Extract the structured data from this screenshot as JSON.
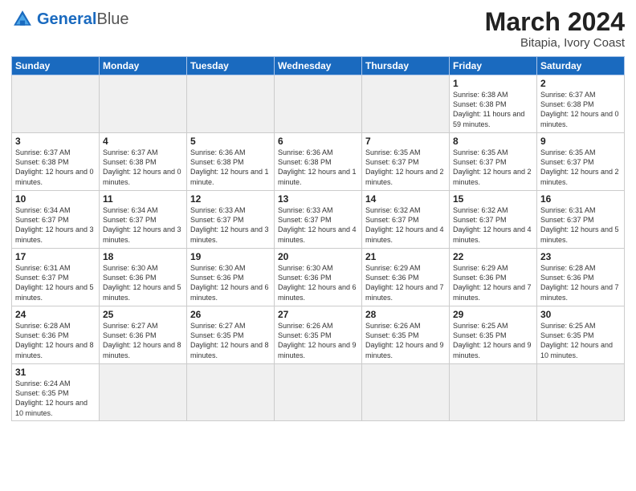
{
  "header": {
    "logo_general": "General",
    "logo_blue": "Blue",
    "month_year": "March 2024",
    "location": "Bitapia, Ivory Coast"
  },
  "days_of_week": [
    "Sunday",
    "Monday",
    "Tuesday",
    "Wednesday",
    "Thursday",
    "Friday",
    "Saturday"
  ],
  "weeks": [
    [
      {
        "day": "",
        "info": ""
      },
      {
        "day": "",
        "info": ""
      },
      {
        "day": "",
        "info": ""
      },
      {
        "day": "",
        "info": ""
      },
      {
        "day": "",
        "info": ""
      },
      {
        "day": "1",
        "info": "Sunrise: 6:38 AM\nSunset: 6:38 PM\nDaylight: 11 hours\nand 59 minutes."
      },
      {
        "day": "2",
        "info": "Sunrise: 6:37 AM\nSunset: 6:38 PM\nDaylight: 12 hours\nand 0 minutes."
      }
    ],
    [
      {
        "day": "3",
        "info": "Sunrise: 6:37 AM\nSunset: 6:38 PM\nDaylight: 12 hours\nand 0 minutes."
      },
      {
        "day": "4",
        "info": "Sunrise: 6:37 AM\nSunset: 6:38 PM\nDaylight: 12 hours\nand 0 minutes."
      },
      {
        "day": "5",
        "info": "Sunrise: 6:36 AM\nSunset: 6:38 PM\nDaylight: 12 hours\nand 1 minute."
      },
      {
        "day": "6",
        "info": "Sunrise: 6:36 AM\nSunset: 6:38 PM\nDaylight: 12 hours\nand 1 minute."
      },
      {
        "day": "7",
        "info": "Sunrise: 6:35 AM\nSunset: 6:37 PM\nDaylight: 12 hours\nand 2 minutes."
      },
      {
        "day": "8",
        "info": "Sunrise: 6:35 AM\nSunset: 6:37 PM\nDaylight: 12 hours\nand 2 minutes."
      },
      {
        "day": "9",
        "info": "Sunrise: 6:35 AM\nSunset: 6:37 PM\nDaylight: 12 hours\nand 2 minutes."
      }
    ],
    [
      {
        "day": "10",
        "info": "Sunrise: 6:34 AM\nSunset: 6:37 PM\nDaylight: 12 hours\nand 3 minutes."
      },
      {
        "day": "11",
        "info": "Sunrise: 6:34 AM\nSunset: 6:37 PM\nDaylight: 12 hours\nand 3 minutes."
      },
      {
        "day": "12",
        "info": "Sunrise: 6:33 AM\nSunset: 6:37 PM\nDaylight: 12 hours\nand 3 minutes."
      },
      {
        "day": "13",
        "info": "Sunrise: 6:33 AM\nSunset: 6:37 PM\nDaylight: 12 hours\nand 4 minutes."
      },
      {
        "day": "14",
        "info": "Sunrise: 6:32 AM\nSunset: 6:37 PM\nDaylight: 12 hours\nand 4 minutes."
      },
      {
        "day": "15",
        "info": "Sunrise: 6:32 AM\nSunset: 6:37 PM\nDaylight: 12 hours\nand 4 minutes."
      },
      {
        "day": "16",
        "info": "Sunrise: 6:31 AM\nSunset: 6:37 PM\nDaylight: 12 hours\nand 5 minutes."
      }
    ],
    [
      {
        "day": "17",
        "info": "Sunrise: 6:31 AM\nSunset: 6:37 PM\nDaylight: 12 hours\nand 5 minutes."
      },
      {
        "day": "18",
        "info": "Sunrise: 6:30 AM\nSunset: 6:36 PM\nDaylight: 12 hours\nand 5 minutes."
      },
      {
        "day": "19",
        "info": "Sunrise: 6:30 AM\nSunset: 6:36 PM\nDaylight: 12 hours\nand 6 minutes."
      },
      {
        "day": "20",
        "info": "Sunrise: 6:30 AM\nSunset: 6:36 PM\nDaylight: 12 hours\nand 6 minutes."
      },
      {
        "day": "21",
        "info": "Sunrise: 6:29 AM\nSunset: 6:36 PM\nDaylight: 12 hours\nand 7 minutes."
      },
      {
        "day": "22",
        "info": "Sunrise: 6:29 AM\nSunset: 6:36 PM\nDaylight: 12 hours\nand 7 minutes."
      },
      {
        "day": "23",
        "info": "Sunrise: 6:28 AM\nSunset: 6:36 PM\nDaylight: 12 hours\nand 7 minutes."
      }
    ],
    [
      {
        "day": "24",
        "info": "Sunrise: 6:28 AM\nSunset: 6:36 PM\nDaylight: 12 hours\nand 8 minutes."
      },
      {
        "day": "25",
        "info": "Sunrise: 6:27 AM\nSunset: 6:36 PM\nDaylight: 12 hours\nand 8 minutes."
      },
      {
        "day": "26",
        "info": "Sunrise: 6:27 AM\nSunset: 6:35 PM\nDaylight: 12 hours\nand 8 minutes."
      },
      {
        "day": "27",
        "info": "Sunrise: 6:26 AM\nSunset: 6:35 PM\nDaylight: 12 hours\nand 9 minutes."
      },
      {
        "day": "28",
        "info": "Sunrise: 6:26 AM\nSunset: 6:35 PM\nDaylight: 12 hours\nand 9 minutes."
      },
      {
        "day": "29",
        "info": "Sunrise: 6:25 AM\nSunset: 6:35 PM\nDaylight: 12 hours\nand 9 minutes."
      },
      {
        "day": "30",
        "info": "Sunrise: 6:25 AM\nSunset: 6:35 PM\nDaylight: 12 hours\nand 10 minutes."
      }
    ],
    [
      {
        "day": "31",
        "info": "Sunrise: 6:24 AM\nSunset: 6:35 PM\nDaylight: 12 hours\nand 10 minutes."
      },
      {
        "day": "",
        "info": ""
      },
      {
        "day": "",
        "info": ""
      },
      {
        "day": "",
        "info": ""
      },
      {
        "day": "",
        "info": ""
      },
      {
        "day": "",
        "info": ""
      },
      {
        "day": "",
        "info": ""
      }
    ]
  ]
}
